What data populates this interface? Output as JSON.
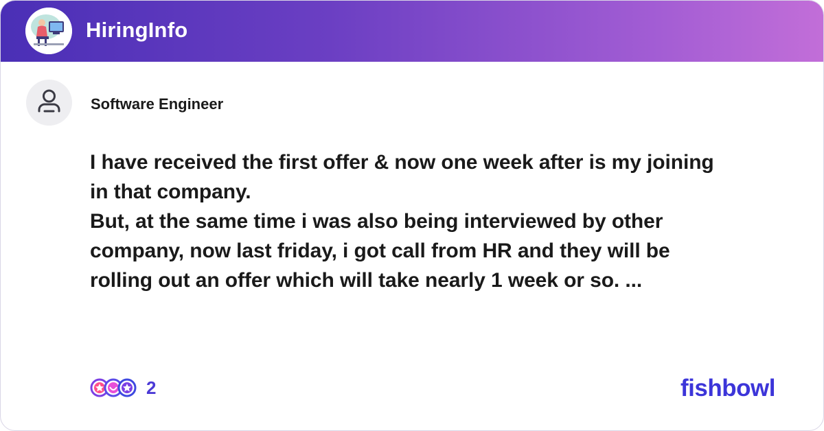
{
  "header": {
    "group_name": "HiringInfo",
    "gradient_start": "#4a2fb6",
    "gradient_end": "#c26ed8",
    "group_icon": "group-illustration-icon"
  },
  "post": {
    "author_title": "Software Engineer",
    "author_icon": "user-silhouette-icon",
    "body_lines": [
      "I have received the first offer & now one week after is my joining",
      "in that company.",
      "But, at the same time i was also being interviewed by other",
      "company, now last friday, i got call from HR and they will be",
      "rolling out an offer which will take nearly 1 week or so. ..."
    ]
  },
  "footer": {
    "reaction_icon": "reaction-emojis-icon",
    "reaction_count": "2",
    "brand": "fishbowl",
    "brand_color": "#3c35d9"
  }
}
